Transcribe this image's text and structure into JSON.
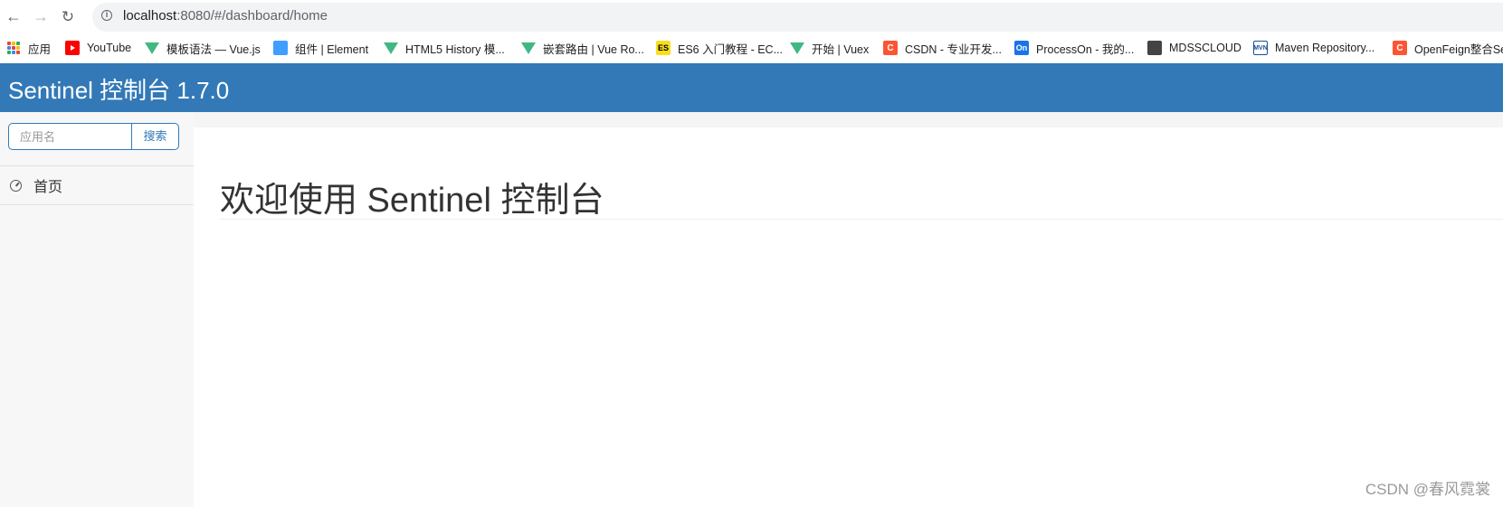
{
  "browser": {
    "url_host": "localhost",
    "url_rest": ":8080/#/dashboard/home",
    "bookmarks": [
      {
        "label": "应用",
        "icon": "apps-grid-icon"
      },
      {
        "label": "YouTube",
        "icon": "youtube-icon"
      },
      {
        "label": "模板语法 — Vue.js",
        "icon": "vue-icon"
      },
      {
        "label": "组件 | Element",
        "icon": "element-icon"
      },
      {
        "label": "HTML5 History 模...",
        "icon": "vue-icon"
      },
      {
        "label": "嵌套路由 | Vue Ro...",
        "icon": "vue-icon"
      },
      {
        "label": "ES6 入门教程 - EC...",
        "icon": "es-icon",
        "icon_text": "ES"
      },
      {
        "label": "开始 | Vuex",
        "icon": "vue-icon"
      },
      {
        "label": "CSDN - 专业开发...",
        "icon": "csdn-icon",
        "icon_text": "C"
      },
      {
        "label": "ProcessOn - 我的...",
        "icon": "processon-icon",
        "icon_text": "On"
      },
      {
        "label": "MDSSCLOUD",
        "icon": "globe-icon"
      },
      {
        "label": "Maven Repository...",
        "icon": "maven-icon",
        "icon_text": "MVN"
      },
      {
        "label": "OpenFeign整合Se",
        "icon": "csdn-icon",
        "icon_text": "C"
      }
    ]
  },
  "header": {
    "title": "Sentinel 控制台 1.7.0"
  },
  "sidebar": {
    "search_placeholder": "应用名",
    "search_button": "搜索",
    "menu": [
      {
        "label": "首页",
        "icon": "clock-icon"
      }
    ]
  },
  "main": {
    "welcome": "欢迎使用 Sentinel 控制台"
  },
  "watermark": "CSDN @春风霓裳",
  "colors": {
    "header_bg": "#3379b7",
    "sidebar_bg": "#f7f7f7",
    "accent": "#3379b7"
  }
}
